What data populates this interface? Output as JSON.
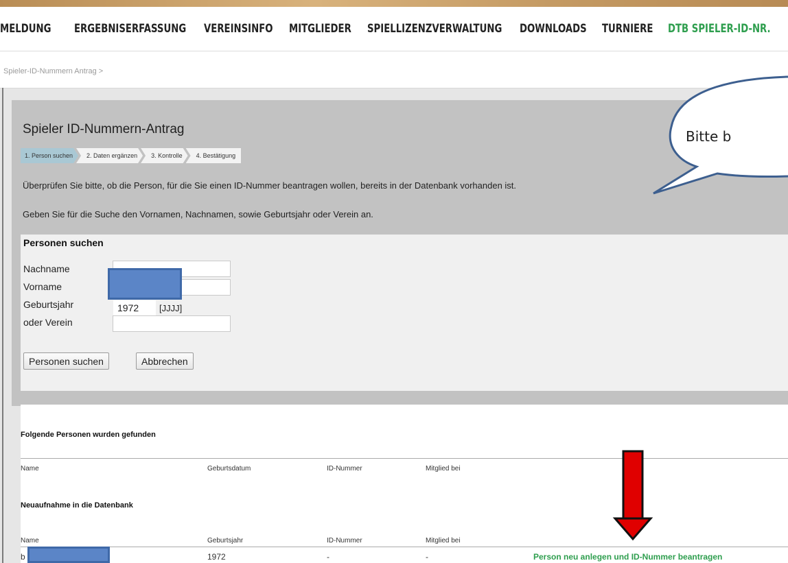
{
  "nav": {
    "items": [
      {
        "label": "MELDUNG"
      },
      {
        "label": "ERGEBNISERFASSUNG"
      },
      {
        "label": "VEREINSINFO"
      },
      {
        "label": "MITGLIEDER"
      },
      {
        "label": "SPIELLIZENZVERWALTUNG"
      },
      {
        "label": "DOWNLOADS"
      },
      {
        "label": "TURNIERE"
      },
      {
        "label": "DTB SPIELER-ID-NR.",
        "active": true
      }
    ],
    "active_color": "#2e9e4e"
  },
  "breadcrumb": "Spieler-ID-Nummern Antrag >",
  "page": {
    "title": "Spieler ID-Nummern-Antrag",
    "steps": [
      "1. Person suchen",
      "2. Daten ergänzen",
      "3. Kontrolle",
      "4. Bestätigung"
    ],
    "info1": "Überprüfen Sie bitte, ob die Person, für die Sie einen ID-Nummer beantragen wollen, bereits in der Datenbank vorhanden ist.",
    "info2": "Geben Sie für die Suche den Vornamen, Nachnamen, sowie Geburtsjahr oder Verein an."
  },
  "search": {
    "heading": "Personen suchen",
    "fields": [
      {
        "label": "Nachname",
        "value": ""
      },
      {
        "label": "Vorname",
        "value": ""
      },
      {
        "label": "Geburtsjahr",
        "value": "1972"
      },
      {
        "label": "oder Verein",
        "value": ""
      }
    ],
    "year_hint": "[JJJJ]",
    "search_button": "Personen suchen",
    "cancel_button": "Abbrechen"
  },
  "results": {
    "found_heading": "Folgende Personen wurden gefunden",
    "found_columns": [
      "Name",
      "Geburtsdatum",
      "ID-Nummer",
      "Mitglied bei"
    ],
    "new_heading": "Neuaufnahme in die Datenbank",
    "new_columns": [
      "Name",
      "Geburtsjahr",
      "ID-Nummer",
      "Mitglied bei"
    ],
    "new_row": {
      "name": "b",
      "year": "1972",
      "id": "-",
      "member": "-",
      "action": "Person neu anlegen und ID-Nummer beantragen"
    }
  },
  "annotation": {
    "bubble_text": "Bitte b",
    "arrow_color": "#e00000",
    "bubble_stroke": "#3d5f8f"
  }
}
